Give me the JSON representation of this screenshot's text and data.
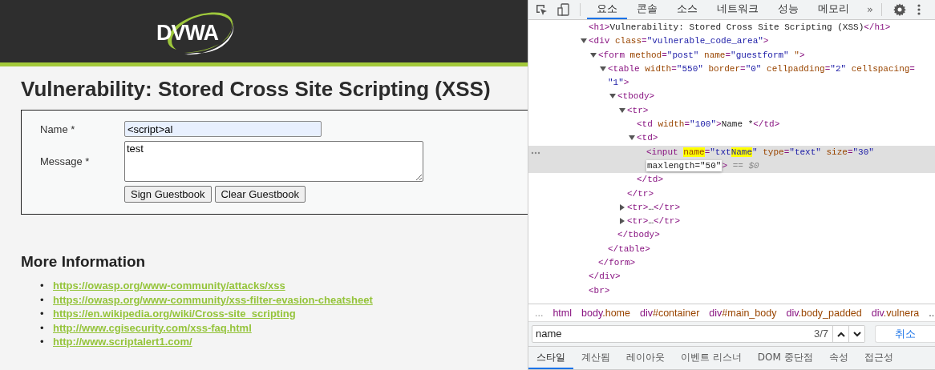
{
  "page": {
    "logo": "DVWA",
    "title": "Vulnerability: Stored Cross Site Scripting (XSS)",
    "form": {
      "fields": [
        {
          "label": "Name *",
          "kind": "input",
          "value": "<script>al"
        },
        {
          "label": "Message *",
          "kind": "textarea",
          "value": "test"
        }
      ],
      "buttons": [
        "Sign Guestbook",
        "Clear Guestbook"
      ]
    },
    "more_info": {
      "heading": "More Information",
      "marker": "•",
      "links": [
        "https://owasp.org/www-community/attacks/xss",
        "https://owasp.org/www-community/xss-filter-evasion-cheatsheet",
        "https://en.wikipedia.org/wiki/Cross-site_scripting",
        "http://www.cgisecurity.com/xss-faq.html",
        "http://www.scriptalert1.com/"
      ]
    }
  },
  "devtools": {
    "tabs": [
      {
        "label": "요소",
        "selected": true
      },
      {
        "label": "콘솔",
        "selected": false
      },
      {
        "label": "소스",
        "selected": false
      },
      {
        "label": "네트워크",
        "selected": false
      },
      {
        "label": "성능",
        "selected": false
      },
      {
        "label": "메모리",
        "selected": false
      }
    ],
    "more_tabs": "»",
    "dom_tree": [
      {
        "selected": false,
        "lines": [
          [
            {
              "kind": "tag",
              "text": "<h1>"
            },
            {
              "kind": "text",
              "text": "Vulnerability: Stored Cross Site Scripting (XSS)"
            },
            {
              "kind": "tag",
              "text": "</h1>"
            }
          ]
        ]
      },
      {
        "selected": false,
        "expanded": true,
        "lines": [
          [
            {
              "kind": "tag",
              "text": "<div"
            },
            {
              "kind": "attr",
              "text": " class"
            },
            {
              "kind": "tag",
              "text": "="
            },
            {
              "kind": "value",
              "text": "\"vulnerable_code_area\""
            },
            {
              "kind": "tag",
              "text": ">"
            }
          ]
        ],
        "close": [
          [
            {
              "kind": "tag",
              "text": "</div>"
            }
          ]
        ],
        "children": [
          {
            "selected": false,
            "expanded": true,
            "lines": [
              [
                {
                  "kind": "tag",
                  "text": "<form"
                },
                {
                  "kind": "attr",
                  "text": " method"
                },
                {
                  "kind": "tag",
                  "text": "="
                },
                {
                  "kind": "value",
                  "text": "\"post\""
                },
                {
                  "kind": "attr",
                  "text": " name"
                },
                {
                  "kind": "tag",
                  "text": "="
                },
                {
                  "kind": "value",
                  "text": "\"guestform\""
                },
                {
                  "kind": "attr",
                  "text": " \""
                },
                {
                  "kind": "tag",
                  "text": ">"
                }
              ]
            ],
            "close": [
              [
                {
                  "kind": "tag",
                  "text": "</form>"
                }
              ]
            ],
            "children": [
              {
                "selected": false,
                "expanded": true,
                "lines": [
                  [
                    {
                      "kind": "tag",
                      "text": "<table"
                    },
                    {
                      "kind": "attr",
                      "text": " width"
                    },
                    {
                      "kind": "tag",
                      "text": "="
                    },
                    {
                      "kind": "value",
                      "text": "\"550\""
                    },
                    {
                      "kind": "attr",
                      "text": " border"
                    },
                    {
                      "kind": "tag",
                      "text": "="
                    },
                    {
                      "kind": "value",
                      "text": "\"0\""
                    },
                    {
                      "kind": "attr",
                      "text": " cellpadding"
                    },
                    {
                      "kind": "tag",
                      "text": "="
                    },
                    {
                      "kind": "value",
                      "text": "\"2\""
                    },
                    {
                      "kind": "attr",
                      "text": " cellspacing"
                    },
                    {
                      "kind": "tag",
                      "text": "="
                    }
                  ],
                  [
                    {
                      "kind": "value",
                      "text": "\"1\""
                    },
                    {
                      "kind": "tag",
                      "text": ">"
                    }
                  ]
                ],
                "close": [
                  [
                    {
                      "kind": "tag",
                      "text": "</table>"
                    }
                  ]
                ],
                "children": [
                  {
                    "selected": false,
                    "expanded": true,
                    "lines": [
                      [
                        {
                          "kind": "tag",
                          "text": "<tbody>"
                        }
                      ]
                    ],
                    "close": [
                      [
                        {
                          "kind": "tag",
                          "text": "</tbody>"
                        }
                      ]
                    ],
                    "children": [
                      {
                        "selected": false,
                        "expanded": true,
                        "lines": [
                          [
                            {
                              "kind": "tag",
                              "text": "<tr>"
                            }
                          ]
                        ],
                        "close": [
                          [
                            {
                              "kind": "tag",
                              "text": "</tr>"
                            }
                          ]
                        ],
                        "children": [
                          {
                            "selected": false,
                            "lines": [
                              [
                                {
                                  "kind": "tag",
                                  "text": "<td"
                                },
                                {
                                  "kind": "attr",
                                  "text": " width"
                                },
                                {
                                  "kind": "tag",
                                  "text": "="
                                },
                                {
                                  "kind": "value",
                                  "text": "\"100\""
                                },
                                {
                                  "kind": "tag",
                                  "text": ">"
                                },
                                {
                                  "kind": "text",
                                  "text": "Name *"
                                },
                                {
                                  "kind": "tag",
                                  "text": "</td>"
                                }
                              ]
                            ]
                          },
                          {
                            "selected": false,
                            "expanded": true,
                            "lines": [
                              [
                                {
                                  "kind": "tag",
                                  "text": "<td>"
                                }
                              ]
                            ],
                            "close": [
                              [
                                {
                                  "kind": "tag",
                                  "text": "</td>"
                                }
                              ]
                            ],
                            "children": [
                              {
                                "selected": true,
                                "lines": [
                                  [
                                    {
                                      "kind": "tag",
                                      "text": "<input "
                                    },
                                    {
                                      "kind": "attr-match",
                                      "text": "name"
                                    },
                                    {
                                      "kind": "tag",
                                      "text": "="
                                    },
                                    {
                                      "kind": "value",
                                      "text": "\"txt"
                                    },
                                    {
                                      "kind": "value-match",
                                      "text": "Name"
                                    },
                                    {
                                      "kind": "value",
                                      "text": "\""
                                    },
                                    {
                                      "kind": "attr",
                                      "text": " type"
                                    },
                                    {
                                      "kind": "tag",
                                      "text": "="
                                    },
                                    {
                                      "kind": "value",
                                      "text": "\"text\""
                                    },
                                    {
                                      "kind": "attr",
                                      "text": " size"
                                    },
                                    {
                                      "kind": "tag",
                                      "text": "="
                                    },
                                    {
                                      "kind": "value",
                                      "text": "\"30\""
                                    }
                                  ],
                                  [
                                    {
                                      "kind": "edit",
                                      "text": "maxlength=\"50\""
                                    },
                                    {
                                      "kind": "tag",
                                      "text": ">"
                                    },
                                    {
                                      "kind": "ref",
                                      "text": " == $0"
                                    }
                                  ]
                                ]
                              }
                            ]
                          }
                        ]
                      },
                      {
                        "selected": false,
                        "expanded": false,
                        "lines": [
                          [
                            {
                              "kind": "tag",
                              "text": "<tr>"
                            },
                            {
                              "kind": "text",
                              "text": "…"
                            },
                            {
                              "kind": "tag",
                              "text": "</tr>"
                            }
                          ]
                        ]
                      },
                      {
                        "selected": false,
                        "expanded": false,
                        "lines": [
                          [
                            {
                              "kind": "tag",
                              "text": "<tr>"
                            },
                            {
                              "kind": "text",
                              "text": "…"
                            },
                            {
                              "kind": "tag",
                              "text": "</tr>"
                            }
                          ]
                        ]
                      }
                    ]
                  }
                ]
              }
            ]
          }
        ]
      },
      {
        "selected": false,
        "lines": [
          [
            {
              "kind": "tag",
              "text": "<br>"
            }
          ]
        ]
      }
    ],
    "breadcrumb": {
      "leading": "...",
      "items": [
        {
          "tag": "html"
        },
        {
          "tag": "body",
          "rest": ".home"
        },
        {
          "tag": "div",
          "rest": "#container"
        },
        {
          "tag": "div",
          "rest": "#main_body"
        },
        {
          "tag": "div",
          "rest": ".body_padded"
        },
        {
          "tag": "div",
          "rest": ".vulnera"
        }
      ],
      "trailing": "..."
    },
    "search": {
      "value": "name",
      "count": "3/7",
      "cancel": "취소"
    },
    "panel_tabs": [
      {
        "label": "스타일",
        "selected": true
      },
      {
        "label": "계산됨",
        "selected": false
      },
      {
        "label": "레이아웃",
        "selected": false
      },
      {
        "label": "이벤트 리스너",
        "selected": false
      },
      {
        "label": "DOM 중단점",
        "selected": false
      },
      {
        "label": "속성",
        "selected": false
      },
      {
        "label": "접근성",
        "selected": false
      }
    ]
  }
}
